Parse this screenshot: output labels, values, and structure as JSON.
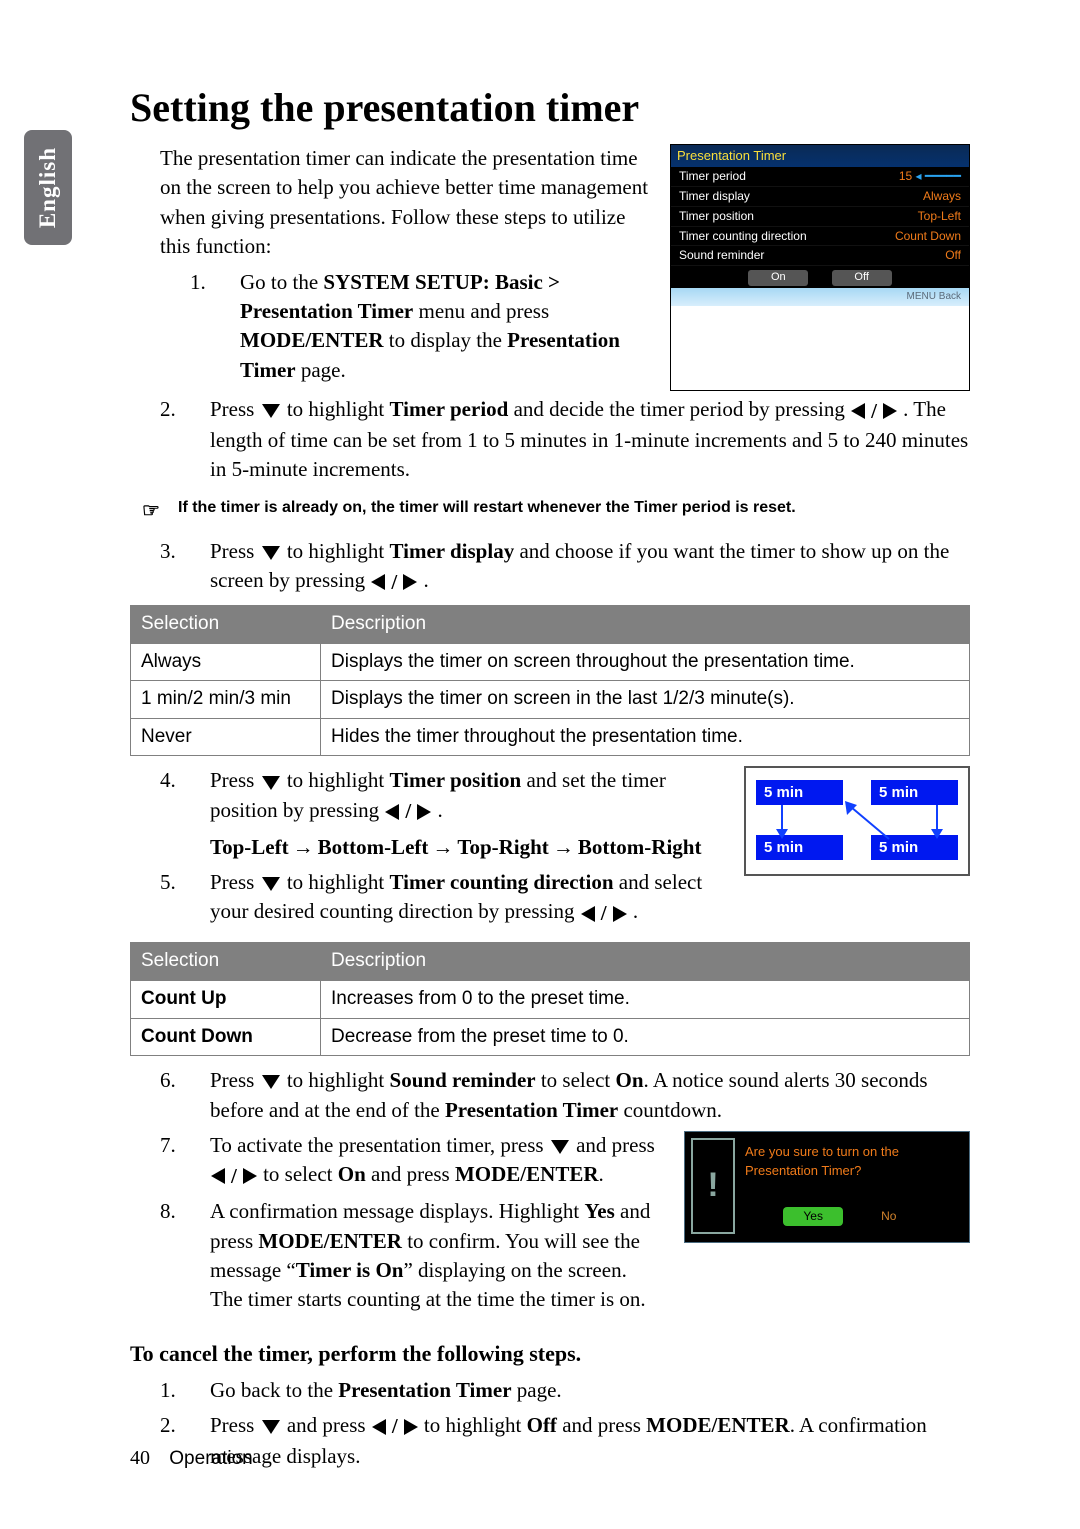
{
  "sideTab": "English",
  "title": "Setting the presentation timer",
  "intro": "The presentation timer can indicate the presentation time on the screen to help you achieve better time management when giving presentations. Follow these steps to utilize this function:",
  "osd": {
    "title": "Presentation Timer",
    "rows": [
      {
        "label": "Timer period",
        "value": "15"
      },
      {
        "label": "Timer display",
        "value": "Always"
      },
      {
        "label": "Timer position",
        "value": "Top-Left"
      },
      {
        "label": "Timer counting direction",
        "value": "Count Down"
      },
      {
        "label": "Sound reminder",
        "value": "Off"
      }
    ],
    "btnOn": "On",
    "btnOff": "Off",
    "footer": "MENU Back"
  },
  "step1_pre": "Go to the ",
  "step1_b1": "SYSTEM SETUP: Basic > Presentation Timer",
  "step1_mid1": " menu and press ",
  "step1_b2": "MODE/ENTER",
  "step1_mid2": " to display the ",
  "step1_b3": "Presentation Timer",
  "step1_end": " page.",
  "step2_a": "Press ",
  "step2_b": " to highlight ",
  "step2_bold": "Timer period",
  "step2_c": " and decide the timer period by pressing ",
  "step2_d": " . The length of time can be set from 1 to 5 minutes in 1-minute increments and 5 to 240 minutes in 5-minute increments.",
  "note1": "If the timer is already on, the timer will restart whenever the Timer period is reset.",
  "step3_a": "Press ",
  "step3_b": " to highlight ",
  "step3_bold": "Timer display",
  "step3_c": " and choose if you want the timer to show up on the screen by pressing ",
  "step3_d": " .",
  "table1": {
    "h1": "Selection",
    "h2": "Description",
    "rows": [
      {
        "s": "Always",
        "d": "Displays the timer on screen throughout the presentation time."
      },
      {
        "s": "1 min/2 min/3 min",
        "d": "Displays the timer on screen in the last 1/2/3 minute(s)."
      },
      {
        "s": "Never",
        "d": "Hides the timer throughout the presentation time."
      }
    ]
  },
  "step4_a": "Press ",
  "step4_b": " to highlight ",
  "step4_bold": "Timer position",
  "step4_c": " and set the timer position by pressing ",
  "step4_d": " .",
  "seq": {
    "a": "Top-Left",
    "b": "Bottom-Left",
    "c": "Top-Right",
    "d": "Bottom-Right"
  },
  "step5_a": "Press ",
  "step5_b": " to highlight ",
  "step5_bold": "Timer counting direction",
  "step5_c": " and select your desired counting direction by pressing ",
  "step5_d": " .",
  "posChip": "5 min",
  "table2": {
    "h1": "Selection",
    "h2": "Description",
    "rows": [
      {
        "s": "Count Up",
        "d": "Increases from 0 to the preset time."
      },
      {
        "s": "Count Down",
        "d": "Decrease from the preset time to 0."
      }
    ]
  },
  "step6_a": "Press ",
  "step6_b": " to highlight ",
  "step6_bold": "Sound reminder",
  "step6_c": " to select ",
  "step6_on": "On",
  "step6_d": ". A notice sound alerts 30 seconds before and at the end of the ",
  "step6_bold2": "Presentation Timer",
  "step6_e": " countdown.",
  "step7_a": "To activate the presentation timer, press ",
  "step7_b": " and press ",
  "step7_c": " to select ",
  "step7_on": "On",
  "step7_d": " and press ",
  "step7_bold": "MODE/ENTER",
  "step7_e": ".",
  "step8_a": "A confirmation message displays. Highlight ",
  "step8_yes": "Yes",
  "step8_b": " and press ",
  "step8_bold": "MODE/ENTER",
  "step8_c": " to confirm. You will see the message “",
  "step8_bold2": "Timer is On",
  "step8_d": "” displaying on the screen. The timer starts counting at the time the timer is on.",
  "confirm": {
    "line1": "Are you sure to turn on the",
    "line2": "Presentation Timer?",
    "yes": "Yes",
    "no": "No"
  },
  "cancelHead": "To cancel the timer, perform the following steps.",
  "cancel1_a": "Go back to the ",
  "cancel1_bold": "Presentation Timer",
  "cancel1_b": " page.",
  "cancel2_a": "Press ",
  "cancel2_b": " and press ",
  "cancel2_c": " to highlight ",
  "cancel2_off": "Off",
  "cancel2_d": " and press ",
  "cancel2_bold": "MODE/ENTER",
  "cancel2_e": ". A confirmation message displays.",
  "footer": {
    "page": "40",
    "section": "Operation"
  }
}
